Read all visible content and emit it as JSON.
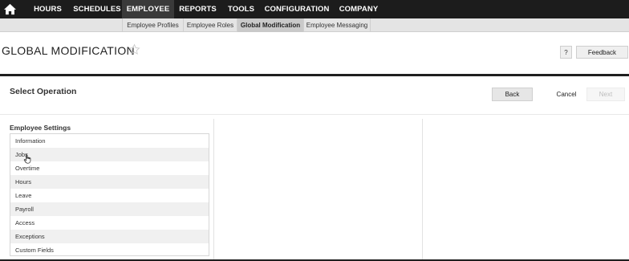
{
  "nav": {
    "home_icon": "home-icon",
    "items": [
      {
        "label": "HOURS"
      },
      {
        "label": "SCHEDULES"
      },
      {
        "label": "EMPLOYEE"
      },
      {
        "label": "REPORTS"
      },
      {
        "label": "TOOLS"
      },
      {
        "label": "CONFIGURATION"
      },
      {
        "label": "COMPANY"
      }
    ],
    "active": "EMPLOYEE"
  },
  "subnav": {
    "items": [
      {
        "label": "Employee Profiles"
      },
      {
        "label": "Employee Roles"
      },
      {
        "label": "Global Modification"
      },
      {
        "label": "Employee Messaging"
      }
    ],
    "active": "Global Modification"
  },
  "header": {
    "title": "GLOBAL MODIFICATION",
    "favorite_icon": "star-icon",
    "help_label": "?",
    "feedback_label": "Feedback"
  },
  "operation": {
    "title": "Select Operation",
    "back_label": "Back",
    "cancel_label": "Cancel",
    "next_label": "Next"
  },
  "settings": {
    "title": "Employee Settings",
    "items": [
      {
        "label": "Information"
      },
      {
        "label": "Jobs"
      },
      {
        "label": "Overtime"
      },
      {
        "label": "Hours"
      },
      {
        "label": "Leave"
      },
      {
        "label": "Payroll"
      },
      {
        "label": "Access"
      },
      {
        "label": "Exceptions"
      },
      {
        "label": "Custom Fields"
      }
    ]
  },
  "colors": {
    "nav_bg": "#1c1c1c",
    "nav_active": "#3a3a3a",
    "subnav_bg": "#e4e4e4",
    "subnav_active": "#c9c9c9",
    "divider": "#1f1f1f"
  }
}
